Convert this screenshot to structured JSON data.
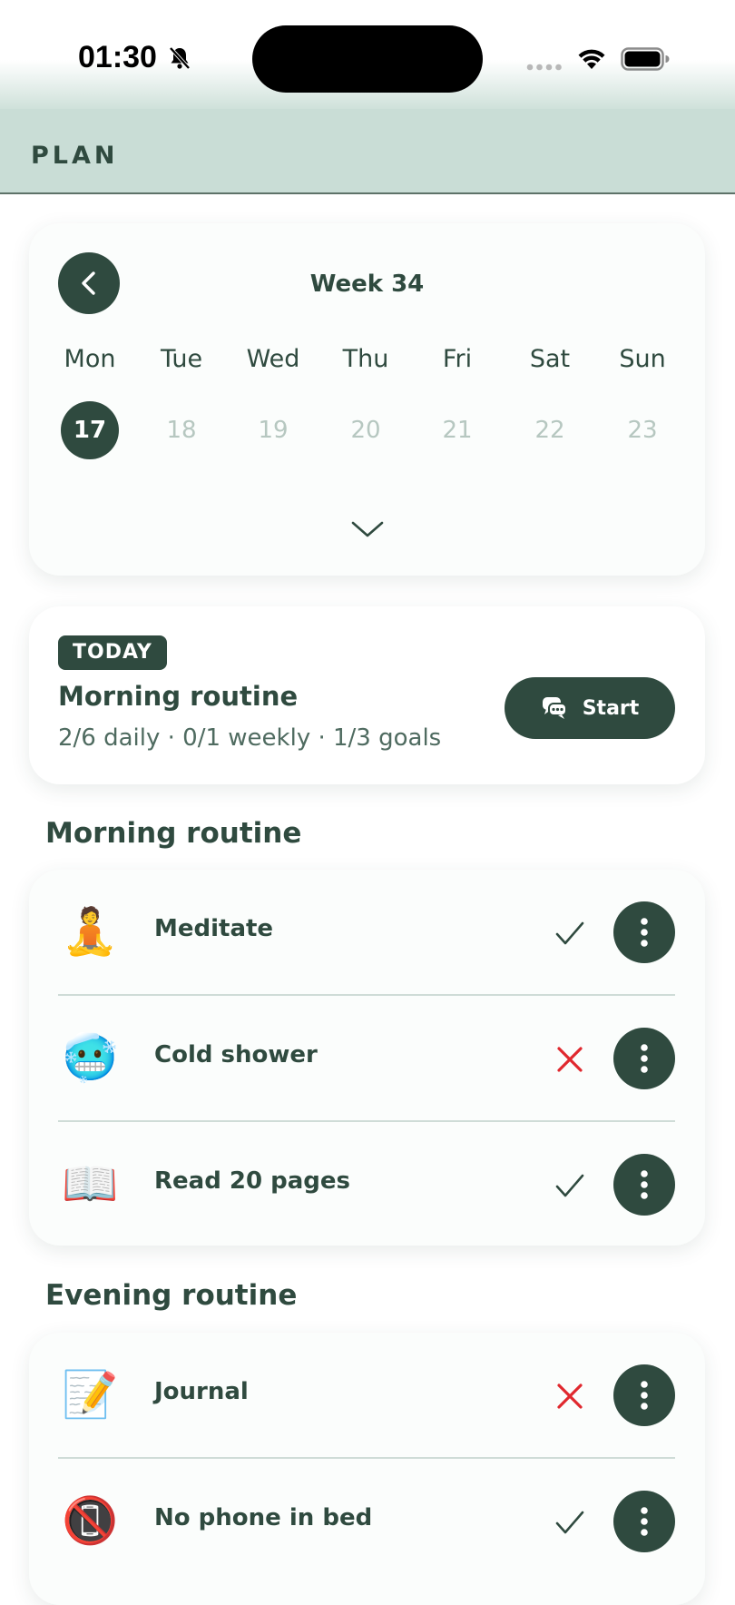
{
  "status_bar": {
    "time": "01:30"
  },
  "app_bar": {
    "title": "PLAN"
  },
  "calendar": {
    "week_title": "Week 34",
    "days": [
      {
        "label": "Mon",
        "date": "17",
        "selected": true
      },
      {
        "label": "Tue",
        "date": "18",
        "selected": false
      },
      {
        "label": "Wed",
        "date": "19",
        "selected": false
      },
      {
        "label": "Thu",
        "date": "20",
        "selected": false
      },
      {
        "label": "Fri",
        "date": "21",
        "selected": false
      },
      {
        "label": "Sat",
        "date": "22",
        "selected": false
      },
      {
        "label": "Sun",
        "date": "23",
        "selected": false
      }
    ]
  },
  "today": {
    "badge": "TODAY",
    "title": "Morning routine",
    "stats": "2/6 daily  ·  0/1 weekly  ·  1/3 goals",
    "start_label": "Start"
  },
  "sections": [
    {
      "title": "Morning routine",
      "items": [
        {
          "emoji": "🧘",
          "icon": "meditation-icon",
          "label": "Meditate",
          "status": "done"
        },
        {
          "emoji": "🥶",
          "icon": "cold-face-icon",
          "label": "Cold shower",
          "status": "missed"
        },
        {
          "emoji": "📖",
          "icon": "book-icon",
          "label": "Read 20 pages",
          "status": "done"
        }
      ]
    },
    {
      "title": "Evening routine",
      "items": [
        {
          "emoji": "📝",
          "icon": "memo-icon",
          "label": "Journal",
          "status": "missed"
        },
        {
          "emoji": "📵",
          "icon": "no-phone-icon",
          "label": "No phone in bed",
          "status": "done"
        }
      ]
    }
  ],
  "colors": {
    "primary": "#2f4a3f",
    "appbar": "#c9ddd6",
    "missed": "#e0282e",
    "muted": "#b6c7c0"
  }
}
